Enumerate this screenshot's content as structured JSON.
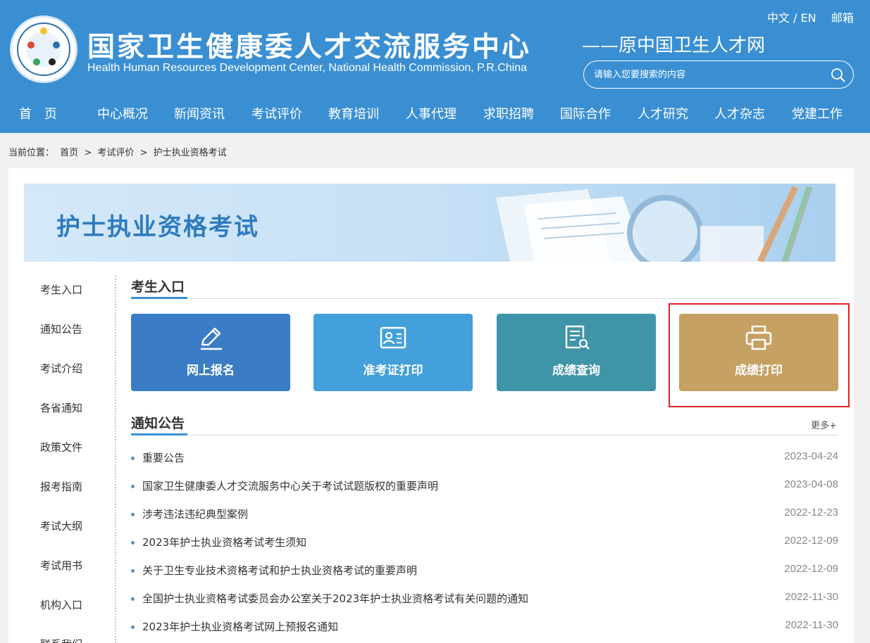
{
  "header": {
    "site_title": "国家卫生健康委人才交流服务中心",
    "site_subtitle": "——原中国卫生人才网",
    "site_title_en": "Health Human Resources Development Center, National Health Commission, P.R.China",
    "lang_switch": "中文 / EN",
    "mail_link": "邮箱",
    "search_placeholder": "请输入您要搜索的内容",
    "nav": [
      "首　页",
      "中心概况",
      "新闻资讯",
      "考试评价",
      "教育培训",
      "人事代理",
      "求职招聘",
      "国际合作",
      "人才研究",
      "人才杂志",
      "党建工作"
    ]
  },
  "breadcrumb": {
    "label": "当前位置：",
    "items": [
      "首页",
      ">",
      "考试评价",
      ">",
      "护士执业资格考试"
    ]
  },
  "banner": {
    "title": "护士执业资格考试"
  },
  "sidebar": {
    "items": [
      "考生入口",
      "通知公告",
      "考试介绍",
      "各省通知",
      "政策文件",
      "报考指南",
      "考试大纲",
      "考试用书",
      "机构入口",
      "联系我们"
    ]
  },
  "entry": {
    "heading": "考生入口",
    "cards": [
      {
        "label": "网上报名",
        "icon": "pencil-icon",
        "color": "#3b7cc6"
      },
      {
        "label": "准考证打印",
        "icon": "id-card-icon",
        "color": "#44a0da"
      },
      {
        "label": "成绩查询",
        "icon": "document-search-icon",
        "color": "#3f94a8"
      },
      {
        "label": "成绩打印",
        "icon": "printer-icon",
        "color": "#c6a164"
      }
    ]
  },
  "notices": {
    "heading": "通知公告",
    "more": "更多+",
    "items": [
      {
        "title": "重要公告",
        "date": "2023-04-24"
      },
      {
        "title": "国家卫生健康委人才交流服务中心关于考试试题版权的重要声明",
        "date": "2023-04-08"
      },
      {
        "title": "涉考违法违纪典型案例",
        "date": "2022-12-23"
      },
      {
        "title": "2023年护士执业资格考试考生须知",
        "date": "2022-12-09"
      },
      {
        "title": "关于卫生专业技术资格考试和护士执业资格考试的重要声明",
        "date": "2022-12-09"
      },
      {
        "title": "全国护士执业资格考试委员会办公室关于2023年护士执业资格考试有关问题的通知",
        "date": "2022-11-30"
      },
      {
        "title": "2023年护士执业资格考试网上预报名通知",
        "date": "2022-11-30"
      }
    ]
  },
  "colors": {
    "header_bg": "#3a8fd3",
    "highlight_border": "#e02020"
  }
}
